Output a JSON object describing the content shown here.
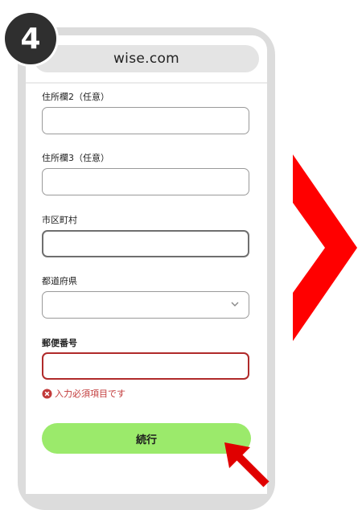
{
  "step_badge": "4",
  "browser": {
    "url": "wise.com"
  },
  "form": {
    "address2": {
      "label": "住所欄2（任意）",
      "value": ""
    },
    "address3": {
      "label": "住所欄3（任意）",
      "value": ""
    },
    "city": {
      "label": "市区町村",
      "value": ""
    },
    "prefecture": {
      "label": "都道府県",
      "selected": ""
    },
    "postal_code": {
      "label": "郵便番号",
      "value": "",
      "error": "入力必須項目です"
    },
    "continue_label": "続行"
  },
  "colors": {
    "button": "#9bea6b",
    "error": "#c23a3a",
    "chevron": "#ff0000",
    "badge": "#2f2f2f"
  },
  "icons": [
    "error-x-icon",
    "chevron-down-icon",
    "red-chevron-right-icon",
    "red-pointer-arrow-icon"
  ]
}
